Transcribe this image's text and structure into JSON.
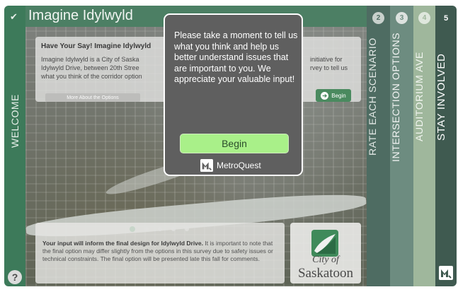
{
  "header": {
    "title": "Imagine Idylwyld"
  },
  "left_rail": {
    "label": "WELCOME",
    "check_icon": "check-icon",
    "help_label": "?"
  },
  "info_card": {
    "title": "Have Your Say! Imagine Idylwyld",
    "body_left": [
      "Imagine Idylwyld is a City of Saska",
      "Idylwyld Drive, between 20th Stree",
      "what you think of the corridor option"
    ],
    "body_right": [
      "initiative for",
      "rvey to tell us",
      ""
    ],
    "more_label": "More About the Options",
    "begin_label": "Begin"
  },
  "bottom_card": {
    "bold": "Your input will inform the final design for Idylwyld Drive.",
    "text": " It is important to note that the final option may differ slightly from the options in this survey due to safety issues or technical constraints. The final option will be presented late this fall for comments."
  },
  "carousel": {
    "count": 5,
    "active_index": 0
  },
  "logo": {
    "city": "City of",
    "name": "Saskatoon"
  },
  "tabs": [
    {
      "number": "2",
      "label": "RATE EACH SCENARIO"
    },
    {
      "number": "3",
      "label": "INTERSECTION OPTIONS"
    },
    {
      "number": "4",
      "label": "AUDITORIUM AVE"
    },
    {
      "number": "5",
      "label": "STAY INVOLVED"
    }
  ],
  "modal": {
    "message": "Please take a moment to tell us what you think and help us better understand issues that are important to you. We appreciate your valuable input!",
    "begin_label": "Begin",
    "brand": "MetroQuest"
  },
  "colors": {
    "rail_green": "#3d7a5a",
    "begin_green": "#a9f089",
    "modal_bg": "#5f5f5f"
  }
}
